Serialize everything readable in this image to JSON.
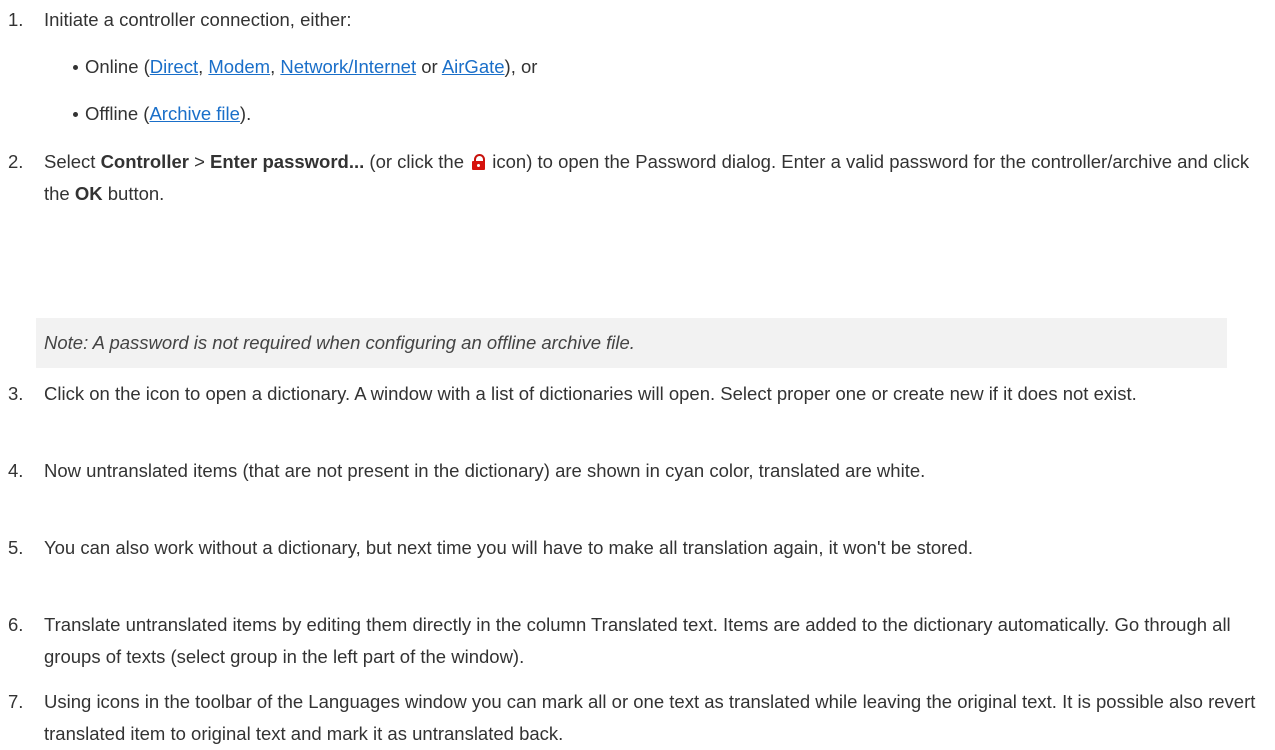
{
  "steps": {
    "s1": {
      "num": "1.",
      "text": "Initiate a controller connection, either:",
      "online": {
        "lead": "Online (",
        "direct": "Direct",
        "sep1": ", ",
        "modem": "Modem",
        "sep2": ", ",
        "network": "Network/Internet",
        "sep3": " or ",
        "airgate": "AirGate",
        "tail": "), or"
      },
      "offline": {
        "lead": "Offline (",
        "archive": "Archive file",
        "tail": ")."
      }
    },
    "s2": {
      "num": "2.",
      "select": "Select ",
      "controller": "Controller",
      "gt": " > ",
      "enter_password": "Enter password...",
      "mid1": " (or click the ",
      "mid2": " icon) to open the Password dialog. Enter a valid password for the controller/archive and click the ",
      "ok": "OK",
      "end": " button."
    },
    "note": "Note: A password is not required when configuring an offline archive file.",
    "s3": {
      "num": "3.",
      "text": "Click on the icon to open a dictionary. A window with a list of dictionaries will open. Select proper one or create new if it does not exist."
    },
    "s4": {
      "num": "4.",
      "text": "Now untranslated items (that are not present in the dictionary) are shown in cyan color, translated are white."
    },
    "s5": {
      "num": "5.",
      "text": "You can also work without a dictionary, but next time you will have to make all translation again, it won't be stored."
    },
    "s6": {
      "num": "6.",
      "text": "Translate untranslated items by editing them directly in the column Translated text. Items are added to the dictionary automatically. Go through all groups of texts (select group in the left part of the window)."
    },
    "s7": {
      "num": "7.",
      "text": "Using icons in the toolbar of the Languages window you can mark all or one text as translated while leaving the original text. It is possible also revert translated item to original text and mark it as untranslated back."
    }
  },
  "icons": {
    "lock": "lock-icon"
  },
  "colors": {
    "link": "#1a6fc9",
    "lock": "#d6130d",
    "note_bg": "#f2f2f2"
  }
}
